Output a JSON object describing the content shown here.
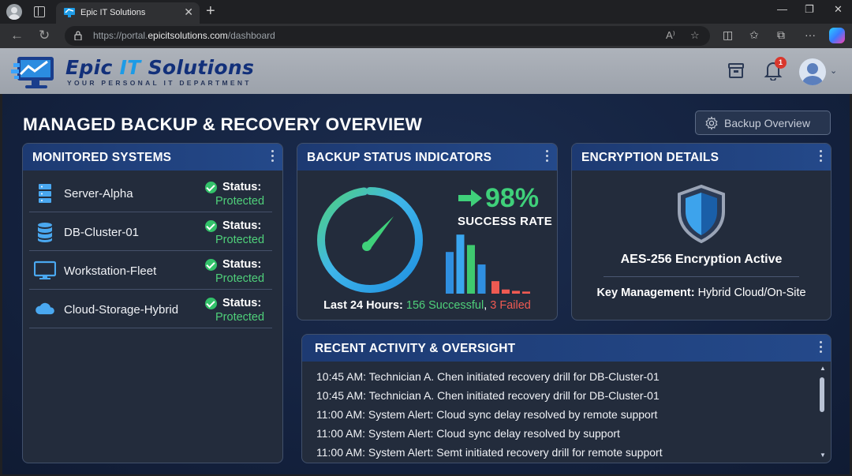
{
  "browser": {
    "tab_title": "Epic IT Solutions",
    "url_prefix": "https://portal.",
    "url_domain": "epicitsolutions.com",
    "url_path": "/dashboard"
  },
  "header": {
    "logo_word1": "Epic",
    "logo_word2": "IT",
    "logo_word3": "Solutions",
    "tagline": "YOUR PERSONAL IT DEPARTMENT",
    "notification_count": "1"
  },
  "page": {
    "title": "MANAGED BACKUP & RECOVERY OVERVIEW",
    "overview_button": "Backup Overview"
  },
  "monitored": {
    "title": "MONITORED SYSTEMS",
    "status_label": "Status:",
    "systems": [
      {
        "name": "Server-Alpha",
        "status": "Protected",
        "icon": "server-icon"
      },
      {
        "name": "DB-Cluster-01",
        "status": "Protected",
        "icon": "database-icon"
      },
      {
        "name": "Workstation-Fleet",
        "status": "Protected",
        "icon": "monitor-icon"
      },
      {
        "name": "Cloud-Storage-Hybrid",
        "status": "Protected",
        "icon": "cloud-icon"
      }
    ]
  },
  "backup": {
    "title": "BACKUP STATUS INDICATORS",
    "success_rate": "98%",
    "success_label": "SUCCESS RATE",
    "gauge_fraction": 0.98,
    "last24_label": "Last 24 Hours:",
    "successful": "156 Successful",
    "separator": ",",
    "failed": "3 Failed",
    "mini_chart": {
      "success_values": [
        60,
        85,
        70,
        42
      ],
      "failed_values": [
        18,
        6,
        4,
        3
      ]
    }
  },
  "encryption": {
    "title": "ENCRYPTION DETAILS",
    "status": "AES-256 Encryption Active",
    "key_label": "Key Management:",
    "key_value": "Hybrid Cloud/On-Site"
  },
  "activity": {
    "title": "RECENT ACTIVITY & OVERSIGHT",
    "entries": [
      "10:45 AM: Technician A. Chen initiated recovery drill for DB-Cluster-01",
      "10:45 AM: Technician A. Chen initiated recovery drill for DB-Cluster-01",
      "11:00 AM: System Alert: Cloud sync delay resolved by remote support",
      "11:00 AM: System Alert: Cloud sync delay resolved by support",
      "11:00 AM: System Alert: Semt initiated recovery drill for remote support"
    ]
  },
  "colors": {
    "success": "#4fd07a",
    "failed": "#ef5a52",
    "accent_blue": "#1d9be6",
    "card_head": "#1d3a72"
  }
}
